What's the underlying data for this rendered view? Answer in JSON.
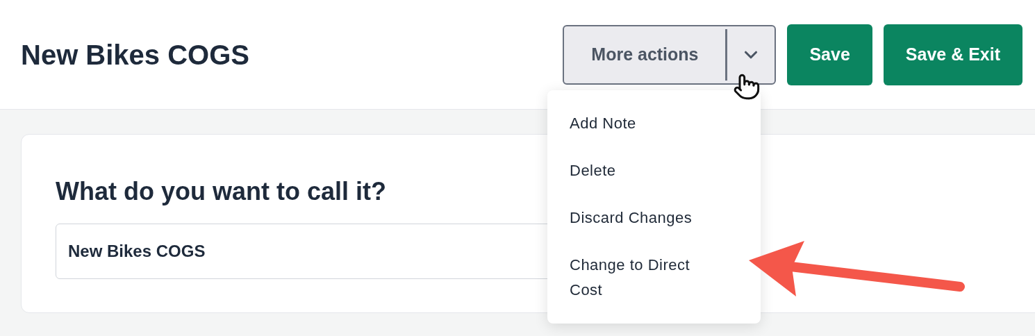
{
  "header": {
    "title": "New Bikes COGS",
    "more_actions": {
      "label": "More actions",
      "expanded": true
    },
    "buttons": [
      "Save",
      "Save & Exit"
    ]
  },
  "menu": {
    "items": [
      "Add Note",
      "Delete",
      "Discard Changes",
      "Change to Direct Cost"
    ]
  },
  "card": {
    "heading": "What do you want to call it?",
    "name_field": {
      "value": "New Bikes COGS"
    }
  }
}
